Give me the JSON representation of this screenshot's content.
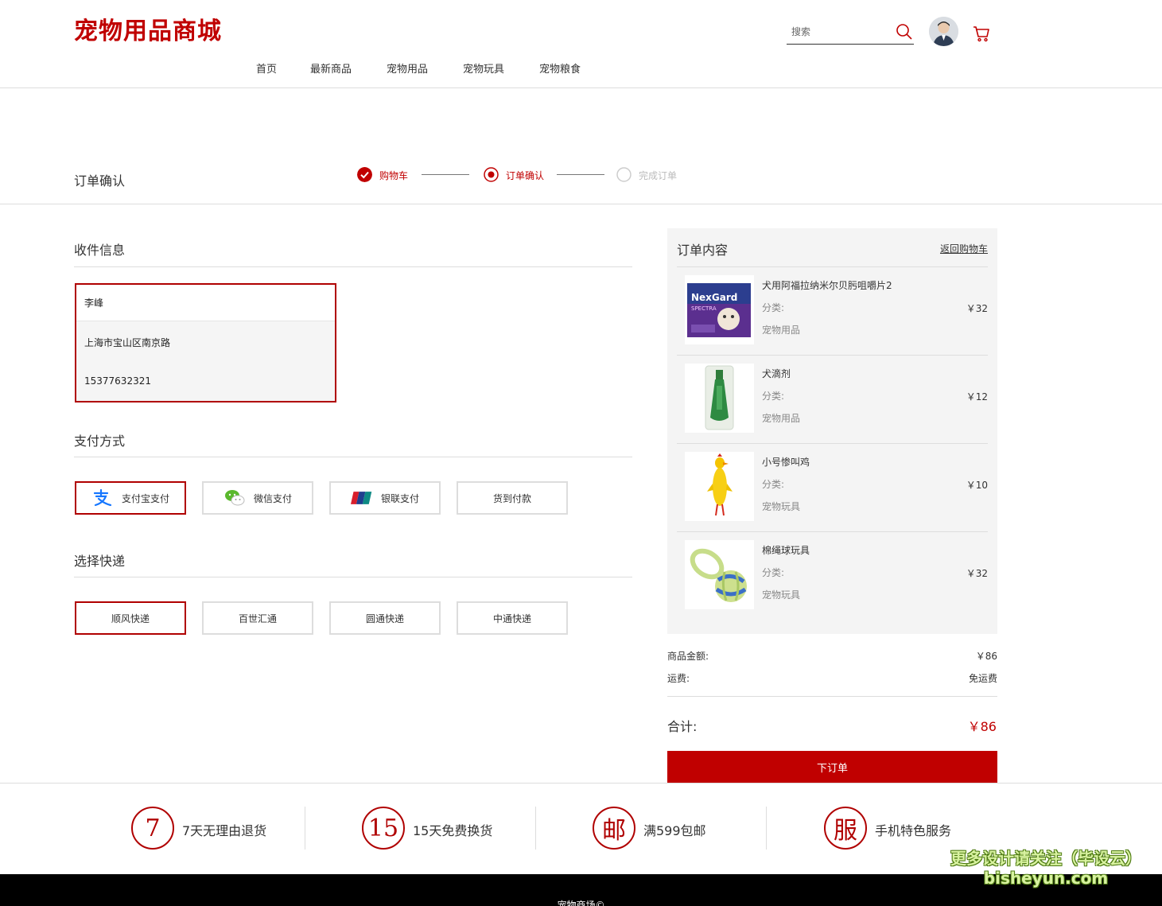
{
  "brand": {
    "logo": "宠物用品商城",
    "accent": "#c00000"
  },
  "nav": {
    "items": [
      {
        "label": "首页"
      },
      {
        "label": "最新商品"
      },
      {
        "label": "宠物用品"
      },
      {
        "label": "宠物玩具"
      },
      {
        "label": "宠物粮食"
      }
    ]
  },
  "search": {
    "placeholder": "搜索"
  },
  "page": {
    "title": "订单确认"
  },
  "steps": [
    {
      "label": "购物车",
      "state": "done"
    },
    {
      "label": "订单确认",
      "state": "active"
    },
    {
      "label": "完成订单",
      "state": "pending"
    }
  ],
  "shipping_info": {
    "title": "收件信息",
    "name": "李峰",
    "address": "上海市宝山区南京路",
    "phone": "15377632321"
  },
  "payment": {
    "title": "支付方式",
    "selected": "支付宝支付",
    "options": [
      {
        "label": "支付宝支付",
        "icon": "alipay-icon"
      },
      {
        "label": "微信支付",
        "icon": "wechat-icon"
      },
      {
        "label": "银联支付",
        "icon": "unionpay-icon"
      },
      {
        "label": "货到付款",
        "icon": ""
      }
    ]
  },
  "express": {
    "title": "选择快递",
    "selected": "顺风快递",
    "options": [
      {
        "label": "顺风快递"
      },
      {
        "label": "百世汇通"
      },
      {
        "label": "圆通快递"
      },
      {
        "label": "中通快递"
      }
    ]
  },
  "order": {
    "title": "订单内容",
    "back_link": "返回购物车",
    "category_label": "分类:",
    "items": [
      {
        "name": "犬用阿福拉纳米尔贝肟咀嚼片2",
        "category": "宠物用品",
        "price": "￥32"
      },
      {
        "name": "犬滴剂",
        "category": "宠物用品",
        "price": "￥12"
      },
      {
        "name": "小号惨叫鸡",
        "category": "宠物玩具",
        "price": "￥10"
      },
      {
        "name": "棉绳球玩具",
        "category": "宠物玩具",
        "price": "￥32"
      }
    ],
    "subtotal_label": "商品金额:",
    "subtotal": "￥86",
    "shipping_label": "运费:",
    "shipping": "免运费",
    "total_label": "合计:",
    "total": "￥86",
    "submit": "下订单"
  },
  "services": [
    {
      "badge": "7",
      "text": "7天无理由退货"
    },
    {
      "badge": "15",
      "text": "15天免费换货"
    },
    {
      "badge": "邮",
      "text": "满599包邮"
    },
    {
      "badge": "服",
      "text": "手机特色服务"
    }
  ],
  "footer": {
    "copyright": "宠物商场©"
  },
  "watermark": {
    "line1": "更多设计请关注（毕设云）",
    "line2": "bisheyun.com"
  }
}
